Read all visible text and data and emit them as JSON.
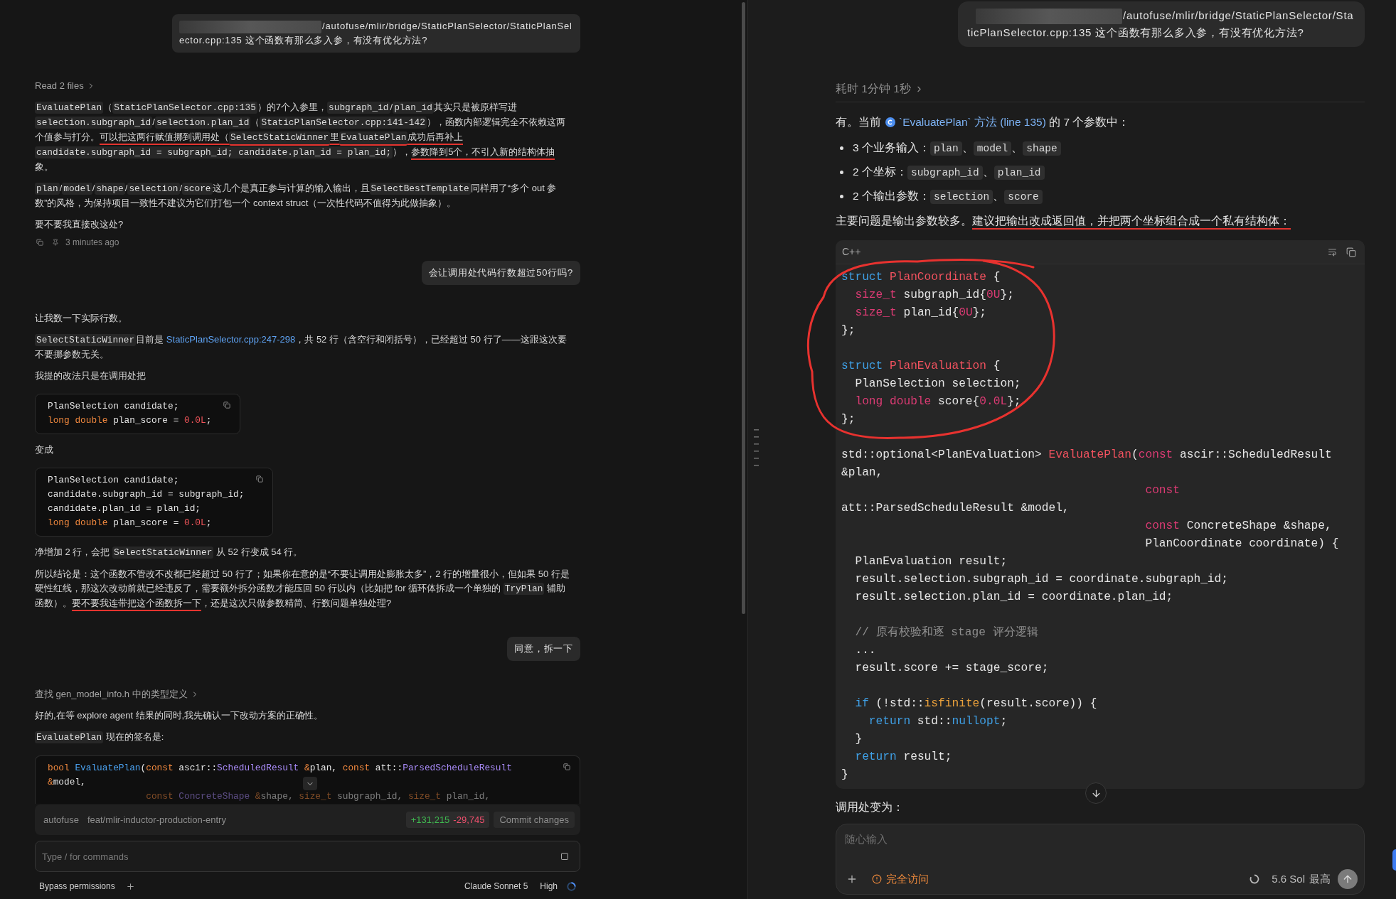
{
  "left_pane": {
    "messages": [
      {
        "kind": "user",
        "redacted_prefix": true,
        "text": "/autofuse/mlir/bridge/StaticPlanSelector/StaticPlanSelector.cpp:135  这个函数有那么多入参，有没有优化方法?"
      },
      {
        "kind": "tool",
        "text": "Read 2 files"
      },
      {
        "kind": "paragraph",
        "parts": [
          {
            "kind": "code",
            "text": "EvaluatePlan",
            "underlined": false
          },
          {
            "kind": "text",
            "text": "（",
            "underlined": false
          },
          {
            "kind": "code",
            "text": "StaticPlanSelector.cpp:135",
            "underlined": false
          },
          {
            "kind": "text",
            "text": "）的7个入参里，",
            "underlined": false
          },
          {
            "kind": "code",
            "text": "subgraph_id",
            "underlined": false
          },
          {
            "kind": "text",
            "text": "/",
            "underlined": false
          },
          {
            "kind": "code",
            "text": "plan_id",
            "underlined": false
          },
          {
            "kind": "text",
            "text": "其实只是被原样写进",
            "underlined": false
          },
          {
            "kind": "code",
            "text": "selection.subgraph_id",
            "underlined": false
          },
          {
            "kind": "text",
            "text": "/",
            "underlined": false
          },
          {
            "kind": "code",
            "text": "selection.plan_id",
            "underlined": false
          },
          {
            "kind": "text",
            "text": "（",
            "underlined": false
          },
          {
            "kind": "code",
            "text": "StaticPlanSelector.cpp:141-142",
            "underlined": false
          },
          {
            "kind": "text",
            "text": "），函数内部逻辑完全不依赖这两个值参与打分。",
            "underlined": false
          },
          {
            "kind": "text",
            "text": "可以把这两行赋值挪到调用处（",
            "underlined": true
          },
          {
            "kind": "code",
            "text": "SelectStaticWinner",
            "underlined": true
          },
          {
            "kind": "text",
            "text": "里",
            "underlined": true
          },
          {
            "kind": "code",
            "text": "EvaluatePlan",
            "underlined": true
          },
          {
            "kind": "text",
            "text": "成功后再补上",
            "underlined": true
          },
          {
            "kind": "code",
            "text": "candidate.subgraph_id = subgraph_id; candidate.plan_id = plan_id;",
            "underlined": false
          },
          {
            "kind": "text",
            "text": "），",
            "underlined": false
          },
          {
            "kind": "text",
            "text": "参数降到5个，不引入新的结构体抽",
            "underlined": true
          },
          {
            "kind": "text",
            "text": "象。",
            "underlined": false
          }
        ]
      },
      {
        "kind": "paragraph",
        "parts": [
          {
            "kind": "code",
            "text": "plan"
          },
          {
            "kind": "text",
            "text": "/"
          },
          {
            "kind": "code",
            "text": "model"
          },
          {
            "kind": "text",
            "text": "/"
          },
          {
            "kind": "code",
            "text": "shape"
          },
          {
            "kind": "text",
            "text": "/"
          },
          {
            "kind": "code",
            "text": "selection"
          },
          {
            "kind": "text",
            "text": "/"
          },
          {
            "kind": "code",
            "text": "score"
          },
          {
            "kind": "text",
            "text": "这几个是真正参与计算的输入输出，且"
          },
          {
            "kind": "code",
            "text": "SelectBestTemplate"
          },
          {
            "kind": "text",
            "text": "同样用了“多个 out 参数”的风格，为保持项目一致性不建议为它们打包一个 context struct（一次性代码不值得为此做抽象）。"
          }
        ]
      },
      {
        "kind": "paragraph",
        "text": "要不要我直接改这处?"
      },
      {
        "kind": "meta",
        "time": "3 minutes ago"
      },
      {
        "kind": "user",
        "redacted_prefix": false,
        "text": "会让调用处代码行数超过50行吗?"
      },
      {
        "kind": "paragraph",
        "text": "让我数一下实际行数。"
      },
      {
        "kind": "paragraph",
        "parts": [
          {
            "kind": "code",
            "text": "SelectStaticWinner"
          },
          {
            "kind": "text",
            "text": "目前是 "
          },
          {
            "kind": "link",
            "text": "StaticPlanSelector.cpp:247-298"
          },
          {
            "kind": "text",
            "text": "，共 52 行（含空行和闭括号），已经超过 50 行了——这跟这次要不要挪参数无关。"
          }
        ]
      },
      {
        "kind": "paragraph",
        "text": "我提的改法只是在调用处把"
      },
      {
        "kind": "code",
        "collapsed": false,
        "lines": [
          [
            {
              "kind": "plain",
              "text": "PlanSelection candidate;"
            }
          ],
          [
            {
              "kind": "keyword",
              "text": "long double"
            },
            {
              "kind": "plain",
              "text": " plan_score = "
            },
            {
              "kind": "number",
              "text": "0.0L"
            },
            {
              "kind": "plain",
              "text": ";"
            }
          ]
        ]
      },
      {
        "kind": "paragraph",
        "text": "变成"
      },
      {
        "kind": "code",
        "collapsed": false,
        "lines": [
          [
            {
              "kind": "plain",
              "text": "PlanSelection candidate;"
            }
          ],
          [
            {
              "kind": "plain",
              "text": "candidate.subgraph_id = subgraph_id;"
            }
          ],
          [
            {
              "kind": "plain",
              "text": "candidate.plan_id = plan_id;"
            }
          ],
          [
            {
              "kind": "keyword",
              "text": "long double"
            },
            {
              "kind": "plain",
              "text": " plan_score = "
            },
            {
              "kind": "number",
              "text": "0.0L"
            },
            {
              "kind": "plain",
              "text": ";"
            }
          ]
        ]
      },
      {
        "kind": "paragraph",
        "parts": [
          {
            "kind": "text",
            "text": "净增加 2 行，会把 "
          },
          {
            "kind": "code",
            "text": "SelectStaticWinner"
          },
          {
            "kind": "text",
            "text": " 从 52 行变成 54 行。"
          }
        ]
      },
      {
        "kind": "paragraph",
        "parts": [
          {
            "kind": "text",
            "text": "所以结论是：这个函数不管改不改都已经超过 50 行了；如果你在意的是“不要让调用处膨胀太多”，2 行的增量很小，但如果 50 行是硬性红线，那这次改动前就已经违反了，需要额外拆分函数才能压回 50 行以内（比如把 for 循环体拆成一个单独的 ",
            "underlined": false
          },
          {
            "kind": "code",
            "text": "TryPlan",
            "underlined": false
          },
          {
            "kind": "text",
            "text": " 辅助函数）。",
            "underlined": false
          },
          {
            "kind": "text",
            "text": "要不要我连带把这个函数拆一下",
            "underlined": true
          },
          {
            "kind": "text",
            "text": "，还是这次只做参数精简、行数问题单独处理?",
            "underlined": false
          }
        ]
      },
      {
        "kind": "user",
        "redacted_prefix": false,
        "text": "同意，拆一下"
      },
      {
        "kind": "tool",
        "text": "查找 gen_model_info.h 中的类型定义"
      },
      {
        "kind": "paragraph",
        "text": "好的,在等 explore agent 结果的同时,我先确认一下改动方案的正确性。"
      },
      {
        "kind": "paragraph",
        "parts": [
          {
            "kind": "code",
            "text": "EvaluatePlan"
          },
          {
            "kind": "text",
            "text": " 现在的签名是:"
          }
        ]
      },
      {
        "kind": "code",
        "collapsed": true,
        "lines": [
          [
            {
              "kind": "keyword",
              "text": "bool"
            },
            {
              "kind": "function",
              "text": " EvaluatePlan"
            },
            {
              "kind": "plain",
              "text": "("
            },
            {
              "kind": "keyword",
              "text": "const"
            },
            {
              "kind": "plain",
              "text": " ascir::"
            },
            {
              "kind": "type",
              "text": "ScheduledResult"
            },
            {
              "kind": "keyword",
              "text": " &"
            },
            {
              "kind": "plain",
              "text": "plan, "
            },
            {
              "kind": "keyword",
              "text": "const"
            },
            {
              "kind": "plain",
              "text": " att::"
            },
            {
              "kind": "type",
              "text": "ParsedScheduleResult"
            }
          ],
          [
            {
              "kind": "keyword",
              "text": "&"
            },
            {
              "kind": "plain",
              "text": "model,"
            }
          ],
          [
            {
              "kind": "keyword",
              "text": "                  const"
            },
            {
              "kind": "type",
              "text": " ConcreteShape"
            },
            {
              "kind": "keyword",
              "text": " &"
            },
            {
              "kind": "plain",
              "text": "shape, "
            },
            {
              "kind": "keyword",
              "text": "size_t"
            },
            {
              "kind": "plain",
              "text": " subgraph_id, "
            },
            {
              "kind": "keyword",
              "text": "size_t"
            },
            {
              "kind": "plain",
              "text": " plan_id,"
            }
          ]
        ]
      }
    ],
    "status_bar": {
      "project": "autofuse",
      "branch": "feat/mlir-inductor-production-entry",
      "added": "+131,215",
      "removed": "-29,745",
      "commit_label": "Commit changes"
    },
    "command_input": {
      "placeholder": "Type / for commands"
    },
    "footer": {
      "permission_mode": "Bypass permissions",
      "model": "Claude Sonnet 5",
      "effort": "High"
    }
  },
  "right_pane": {
    "messages": [
      {
        "kind": "user",
        "redacted_prefix": true,
        "text": "/autofuse/mlir/bridge/StaticPlanSelector/StaticPlanSelector.cpp:135  这个函数有那么多入参，有没有优化方法?"
      },
      {
        "kind": "summary",
        "text": "耗时 1分钟 1秒"
      },
      {
        "kind": "paragraph",
        "parts": [
          {
            "kind": "text",
            "text": "有。当前"
          },
          {
            "kind": "filelink",
            "text": "`EvaluatePlan` 方法 (line 135)"
          },
          {
            "kind": "text",
            "text": " 的 7 个参数中："
          }
        ]
      },
      {
        "kind": "bullets",
        "items": [
          {
            "parts": [
              {
                "kind": "text",
                "text": "3 个业务输入："
              },
              {
                "kind": "code",
                "text": "plan"
              },
              {
                "kind": "text",
                "text": "、"
              },
              {
                "kind": "code",
                "text": "model"
              },
              {
                "kind": "text",
                "text": "、"
              },
              {
                "kind": "code",
                "text": "shape"
              }
            ]
          },
          {
            "parts": [
              {
                "kind": "text",
                "text": "2 个坐标："
              },
              {
                "kind": "code",
                "text": "subgraph_id"
              },
              {
                "kind": "text",
                "text": "、"
              },
              {
                "kind": "code",
                "text": "plan_id"
              }
            ]
          },
          {
            "parts": [
              {
                "kind": "text",
                "text": "2 个输出参数："
              },
              {
                "kind": "code",
                "text": "selection"
              },
              {
                "kind": "text",
                "text": "、"
              },
              {
                "kind": "code",
                "text": "score"
              }
            ]
          }
        ]
      },
      {
        "kind": "paragraph",
        "parts": [
          {
            "kind": "text",
            "text": "主要问题是输出参数较多。",
            "underlined": false
          },
          {
            "kind": "text",
            "text": "建议把输出改成返回值，并把两个坐标组合成一个私有结构体：",
            "underlined": true
          }
        ]
      },
      {
        "kind": "code",
        "language": "C++",
        "groups": [
          {
            "circled": true,
            "lines": [
              {
                "kind": "code",
                "tokens": [
                  {
                    "kind": "keyword",
                    "text": "struct"
                  },
                  {
                    "kind": "declared",
                    "text": " PlanCoordinate"
                  },
                  {
                    "kind": "plain",
                    "text": " {"
                  }
                ]
              },
              {
                "kind": "code",
                "tokens": [
                  {
                    "kind": "builtin",
                    "text": "  size_t"
                  },
                  {
                    "kind": "plain",
                    "text": " subgraph_id{"
                  },
                  {
                    "kind": "builtin",
                    "text": "0U"
                  },
                  {
                    "kind": "plain",
                    "text": "};"
                  }
                ]
              },
              {
                "kind": "code",
                "tokens": [
                  {
                    "kind": "builtin",
                    "text": "  size_t"
                  },
                  {
                    "kind": "plain",
                    "text": " plan_id{"
                  },
                  {
                    "kind": "builtin",
                    "text": "0U"
                  },
                  {
                    "kind": "plain",
                    "text": "};"
                  }
                ]
              },
              {
                "kind": "code",
                "tokens": [
                  {
                    "kind": "plain",
                    "text": "};"
                  }
                ]
              },
              {
                "kind": "blank"
              },
              {
                "kind": "code",
                "tokens": [
                  {
                    "kind": "keyword",
                    "text": "struct"
                  },
                  {
                    "kind": "declared",
                    "text": " PlanEvaluation"
                  },
                  {
                    "kind": "plain",
                    "text": " {"
                  }
                ]
              },
              {
                "kind": "code",
                "tokens": [
                  {
                    "kind": "plain",
                    "text": "  PlanSelection selection;"
                  }
                ]
              },
              {
                "kind": "code",
                "tokens": [
                  {
                    "kind": "builtin",
                    "text": "  long double"
                  },
                  {
                    "kind": "plain",
                    "text": " score{"
                  },
                  {
                    "kind": "builtin",
                    "text": "0.0L"
                  },
                  {
                    "kind": "plain",
                    "text": "};"
                  }
                ]
              },
              {
                "kind": "code",
                "tokens": [
                  {
                    "kind": "plain",
                    "text": "};"
                  }
                ]
              }
            ]
          },
          {
            "circled": false,
            "lines": [
              {
                "kind": "blank"
              },
              {
                "kind": "code",
                "tokens": [
                  {
                    "kind": "plain",
                    "text": "std::optional<PlanEvaluation>"
                  },
                  {
                    "kind": "declared",
                    "text": " EvaluatePlan"
                  },
                  {
                    "kind": "plain",
                    "text": "("
                  },
                  {
                    "kind": "builtin",
                    "text": "const"
                  },
                  {
                    "kind": "plain",
                    "text": " ascir::ScheduledResult"
                  }
                ]
              },
              {
                "kind": "code",
                "tokens": [
                  {
                    "kind": "plain",
                    "text": "&plan,"
                  }
                ]
              },
              {
                "kind": "code",
                "tokens": [
                  {
                    "kind": "builtin",
                    "text": "                                            const"
                  }
                ]
              },
              {
                "kind": "code",
                "tokens": [
                  {
                    "kind": "plain",
                    "text": "att::ParsedScheduleResult &model,"
                  }
                ]
              },
              {
                "kind": "code",
                "tokens": [
                  {
                    "kind": "builtin",
                    "text": "                                            const"
                  },
                  {
                    "kind": "plain",
                    "text": " ConcreteShape &shape,"
                  }
                ]
              },
              {
                "kind": "code",
                "tokens": [
                  {
                    "kind": "plain",
                    "text": "                                            PlanCoordinate coordinate) {"
                  }
                ]
              },
              {
                "kind": "code",
                "tokens": [
                  {
                    "kind": "plain",
                    "text": "  PlanEvaluation result;"
                  }
                ]
              },
              {
                "kind": "code",
                "tokens": [
                  {
                    "kind": "plain",
                    "text": "  result.selection.subgraph_id = coordinate.subgraph_id;"
                  }
                ]
              },
              {
                "kind": "code",
                "tokens": [
                  {
                    "kind": "plain",
                    "text": "  result.selection.plan_id = coordinate.plan_id;"
                  }
                ]
              },
              {
                "kind": "blank"
              },
              {
                "kind": "code",
                "tokens": [
                  {
                    "kind": "comment",
                    "text": "  // 原有校验和逐 stage 评分逻辑"
                  }
                ]
              },
              {
                "kind": "code",
                "tokens": [
                  {
                    "kind": "plain",
                    "text": "  ..."
                  }
                ]
              },
              {
                "kind": "code",
                "tokens": [
                  {
                    "kind": "plain",
                    "text": "  result.score += stage_score;"
                  }
                ]
              },
              {
                "kind": "blank"
              },
              {
                "kind": "code",
                "tokens": [
                  {
                    "kind": "keyword",
                    "text": "  if"
                  },
                  {
                    "kind": "plain",
                    "text": " (!std::"
                  },
                  {
                    "kind": "call",
                    "text": "isfinite"
                  },
                  {
                    "kind": "plain",
                    "text": "(result.score)) {"
                  }
                ]
              },
              {
                "kind": "code",
                "tokens": [
                  {
                    "kind": "keyword",
                    "text": "    return"
                  },
                  {
                    "kind": "plain",
                    "text": " std::"
                  },
                  {
                    "kind": "keyword",
                    "text": "nullopt"
                  },
                  {
                    "kind": "plain",
                    "text": ";"
                  }
                ]
              },
              {
                "kind": "code",
                "tokens": [
                  {
                    "kind": "plain",
                    "text": "  }"
                  }
                ]
              },
              {
                "kind": "code",
                "tokens": [
                  {
                    "kind": "keyword",
                    "text": "  return"
                  },
                  {
                    "kind": "plain",
                    "text": " result;"
                  }
                ]
              },
              {
                "kind": "code",
                "tokens": [
                  {
                    "kind": "plain",
                    "text": "}"
                  }
                ]
              }
            ]
          }
        ]
      },
      {
        "kind": "paragraph",
        "text": "调用处变为："
      }
    ],
    "composer": {
      "placeholder": "随心输入",
      "access_mode": "完全访问",
      "model": "5.6 Sol",
      "effort": "最高"
    }
  }
}
